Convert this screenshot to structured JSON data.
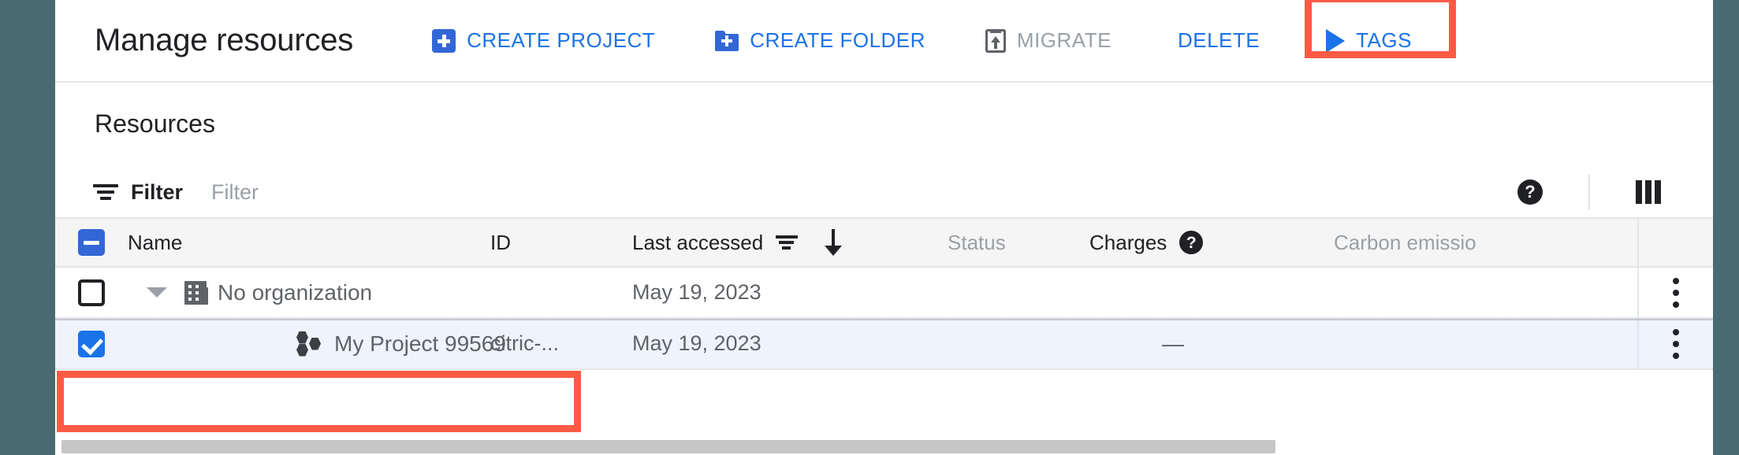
{
  "header": {
    "title": "Manage resources",
    "actions": [
      {
        "id": "create-project",
        "label": "CREATE PROJECT",
        "icon": "create-project-icon",
        "color": "#1a73e8",
        "disabled": false
      },
      {
        "id": "create-folder",
        "label": "CREATE FOLDER",
        "icon": "create-folder-icon",
        "color": "#1a73e8",
        "disabled": false
      },
      {
        "id": "migrate",
        "label": "MIGRATE",
        "icon": "migrate-icon",
        "color": "#9aa0a6",
        "disabled": true
      },
      {
        "id": "delete",
        "label": "DELETE",
        "icon": "none",
        "color": "#1a73e8",
        "disabled": false
      },
      {
        "id": "tags",
        "label": "TAGS",
        "icon": "tags-icon",
        "color": "#1a73e8",
        "disabled": false
      }
    ]
  },
  "section": {
    "title": "Resources"
  },
  "filterbar": {
    "filter_label": "Filter",
    "filter_placeholder": "Filter",
    "filter_icon": "filter-icon",
    "help_icon": "help-icon",
    "help_glyph": "?",
    "columns_icon": "column-display-icon"
  },
  "table": {
    "columns": [
      {
        "key": "name",
        "label": "Name",
        "muted": false
      },
      {
        "key": "id",
        "label": "ID",
        "muted": false
      },
      {
        "key": "last",
        "label": "Last accessed",
        "muted": false,
        "has_filter": true,
        "sort": "desc"
      },
      {
        "key": "status",
        "label": "Status",
        "muted": true
      },
      {
        "key": "charges",
        "label": "Charges",
        "muted": false,
        "has_help": true,
        "help_glyph": "?"
      },
      {
        "key": "carbon",
        "label": "Carbon emissio",
        "muted": true,
        "truncated": true
      }
    ],
    "header_checkbox_state": "indeterminate",
    "rows": [
      {
        "id": "row-no-organization",
        "checkbox": "unchecked",
        "expander": "expanded",
        "icon": "organization-icon",
        "name": "No organization",
        "resource_id": "",
        "last_accessed": "May 19, 2023",
        "status": "",
        "charges": "",
        "carbon": "",
        "selected": false,
        "indent": 0
      },
      {
        "id": "row-my-project-99569",
        "checkbox": "checked",
        "expander": "none",
        "icon": "project-icon",
        "name": "My Project 99569",
        "resource_id": "citric-...",
        "last_accessed": "May 19, 2023",
        "status": "",
        "charges": "—",
        "carbon": "",
        "selected": true,
        "indent": 1
      }
    ],
    "row_menu_icon": "kebab-menu-icon"
  },
  "annotations": [
    {
      "id": "annot-delete",
      "target": "delete-button",
      "color": "#fb5b45"
    },
    {
      "id": "annot-project",
      "target": "row-my-project-99569-name-cell",
      "color": "#fb5b45"
    }
  ],
  "scrollbar": {
    "orientation": "horizontal"
  }
}
